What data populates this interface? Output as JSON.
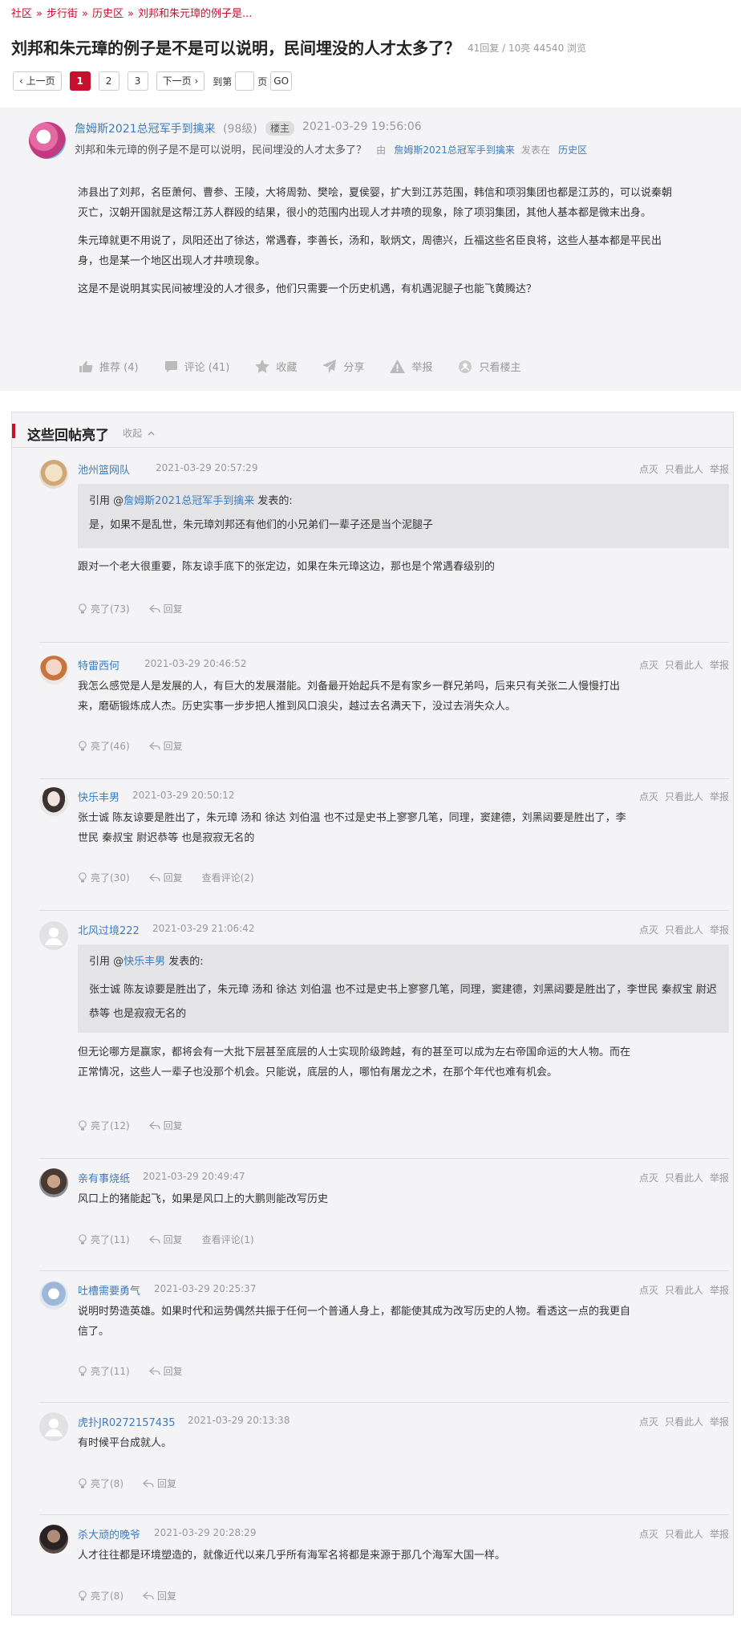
{
  "breadcrumb": [
    "社区",
    "步行街",
    "历史区",
    "刘邦和朱元璋的例子是..."
  ],
  "breadcrumb_sep": "»",
  "thread": {
    "title": "刘邦和朱元璋的例子是不是可以说明，民间埋没的人才太多了？",
    "meta": "41回复 / 10亮 44540 浏览"
  },
  "pager": {
    "prev": "‹ 上一页",
    "pages": [
      "1",
      "2",
      "3"
    ],
    "next": "下一页 ›",
    "jump_to": "到第",
    "page_unit": "页",
    "go": "GO"
  },
  "op": {
    "user": "詹姆斯2021总冠军手到擒来",
    "level": "(98级)",
    "badge": "楼主",
    "time": "2021-03-29 19:56:06",
    "subtitle": "刘邦和朱元璋的例子是不是可以说明，民间埋没的人才太多了？",
    "by": "由",
    "by_user": "詹姆斯2021总冠军手到擒来",
    "posted_in": "发表在",
    "board": "历史区",
    "paragraphs": [
      "沛县出了刘邦，名臣萧何、曹参、王陵，大将周勃、樊哙，夏侯婴，扩大到江苏范围，韩信和项羽集团也都是江苏的，可以说秦朝灭亡，汉朝开国就是这帮江苏人群殴的结果，很小的范围内出现人才井喷的现象，除了项羽集团，其他人基本都是微末出身。",
      "朱元璋就更不用说了，凤阳还出了徐达，常遇春，李善长，汤和，耿炳文，周德兴，丘福这些名臣良将，这些人基本都是平民出身，也是某一个地区出现人才井喷现象。",
      "这是不是说明其实民间被埋没的人才很多，他们只需要一个历史机遇，有机遇泥腿子也能飞黄腾达？"
    ],
    "actions": {
      "recommend": "推荐 (4)",
      "comment": "评论 (41)",
      "collect": "收藏",
      "share": "分享",
      "report": "举报",
      "only_op": "只看楼主"
    }
  },
  "hot": {
    "title": "这些回帖亮了",
    "fold": "收起",
    "action_labels": {
      "dislike": "点灭",
      "only_this": "只看此人",
      "report": "举报",
      "reply": "回复"
    },
    "replies": [
      {
        "user": "池州篮网队",
        "time": "2021-03-29 20:57:29",
        "quote_prefix": "引用 @",
        "quote_user": "詹姆斯2021总冠军手到擒来",
        "quote_suffix": " 发表的:",
        "quote_text": "是，如果不是乱世，朱元璋刘邦还有他们的小兄弟们一辈子还是当个泥腿子",
        "text": "跟对一个老大很重要，陈友谅手底下的张定边，如果在朱元璋这边，那也是个常遇春级别的",
        "light": "亮了(73)"
      },
      {
        "user": "特雷西何",
        "time": "2021-03-29 20:46:52",
        "text": "我怎么感觉是人是发展的人，有巨大的发展潜能。刘备最开始起兵不是有家乡一群兄弟吗，后来只有关张二人慢慢打出来，磨砺锻炼成人杰。历史实事一步步把人推到风口浪尖，越过去名满天下，没过去消失众人。",
        "light": "亮了(46)"
      },
      {
        "user": "快乐丰男",
        "time": "2021-03-29 20:50:12",
        "text": "张士诚 陈友谅要是胜出了，朱元璋 汤和 徐达 刘伯温 也不过是史书上寥寥几笔，同理，窦建德，刘黑闼要是胜出了，李世民 秦叔宝 尉迟恭等 也是寂寂无名的",
        "light": "亮了(30)",
        "comments": "查看评论(2)"
      },
      {
        "user": "北风过境222",
        "time": "2021-03-29 21:06:42",
        "quote_prefix": "引用 @",
        "quote_user": "快乐丰男",
        "quote_suffix": " 发表的:",
        "quote_text": "张士诚 陈友谅要是胜出了，朱元璋 汤和 徐达 刘伯温 也不过是史书上寥寥几笔，同理，窦建德，刘黑闼要是胜出了，李世民 秦叔宝 尉迟恭等 也是寂寂无名的",
        "text": "但无论哪方是赢家，都将会有一大批下层甚至底层的人士实现阶级跨越，有的甚至可以成为左右帝国命运的大人物。而在正常情况，这些人一辈子也没那个机会。只能说，底层的人，哪怕有屠龙之术，在那个年代也难有机会。",
        "light": "亮了(12)"
      },
      {
        "user": "亲有事烧纸",
        "time": "2021-03-29 20:49:47",
        "text": "风口上的猪能起飞，如果是风口上的大鹏则能改写历史",
        "light": "亮了(11)",
        "comments": "查看评论(1)"
      },
      {
        "user": "吐槽需要勇气",
        "time": "2021-03-29 20:25:37",
        "text": "说明时势造英雄。如果时代和运势偶然共振于任何一个普通人身上，都能使其成为改写历史的人物。看透这一点的我更自信了。",
        "light": "亮了(11)"
      },
      {
        "user": "虎扑JR0272157435",
        "time": "2021-03-29 20:13:38",
        "text": "有时候平台成就人。",
        "light": "亮了(8)"
      },
      {
        "user": "杀大顽的晚爷",
        "time": "2021-03-29 20:28:29",
        "text": "人才往往都是环境塑造的，就像近代以来几乎所有海军名将都是来源于那几个海军大国一样。",
        "light": "亮了(8)"
      }
    ]
  }
}
